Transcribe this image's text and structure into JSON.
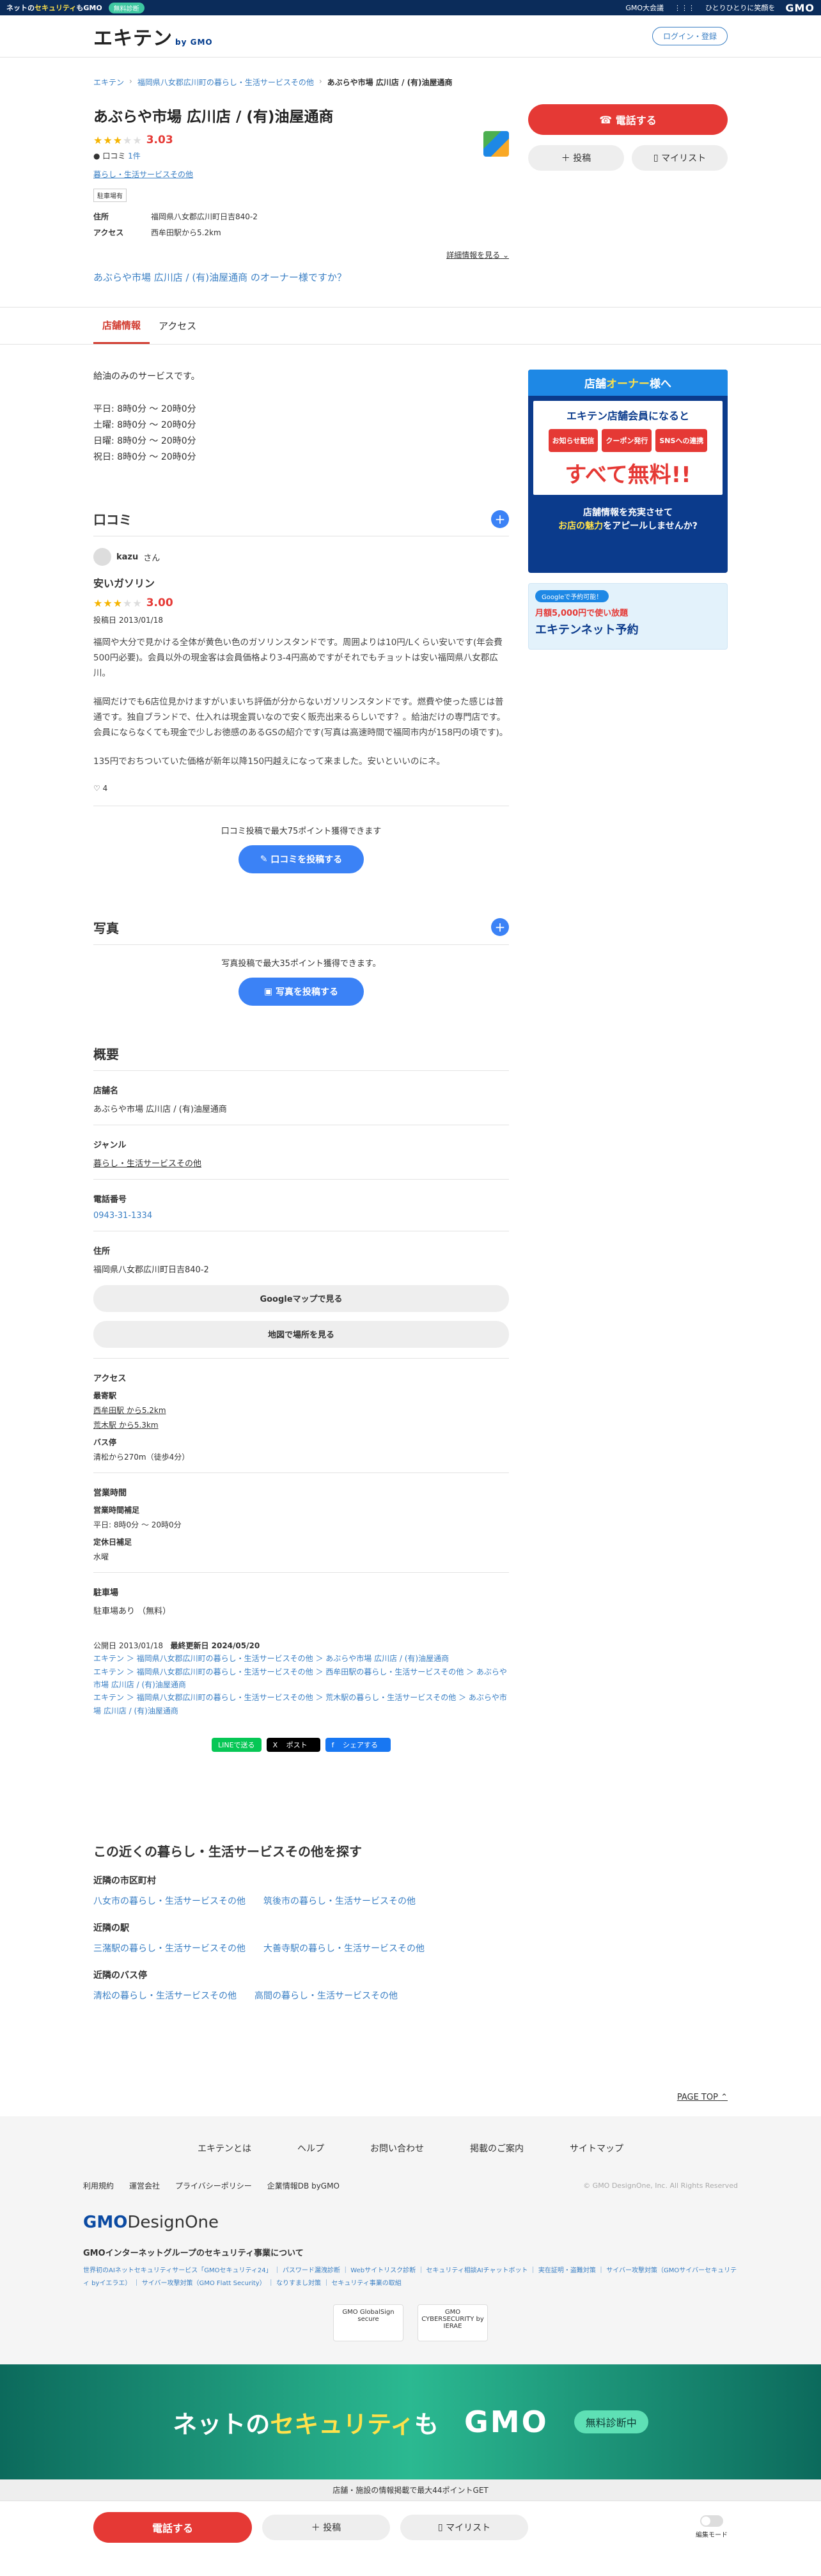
{
  "gmo_bar": {
    "left_text_1": "ネットの",
    "left_text_2": "セキュリティ",
    "left_text_3": "もGMO",
    "pill": "無料診断",
    "mid": "GMO大会議",
    "right_note": "ひとりひとりに笑顔を",
    "logo": "GMO"
  },
  "header": {
    "logo": "エキテン",
    "logo_sub": "by GMO",
    "login": "ログイン・登録"
  },
  "breadcrumb": [
    "エキテン",
    "福岡県八女郡広川町の暮らし・生活サービスその他",
    "あぶらや市場 広川店 / (有)油屋通商"
  ],
  "store": {
    "title": "あぶらや市場 広川店 / (有)油屋通商",
    "score": "3.03",
    "reviews_label": "口コミ",
    "reviews_count": "1件",
    "genre": "暮らし・生活サービスその他",
    "tag": "駐車場有",
    "address_label": "住所",
    "address": "福岡県八女郡広川町日吉840-2",
    "access_label": "アクセス",
    "access": "西牟田駅から5.2km",
    "more": "詳細情報を見る",
    "owner": "あぶらや市場 広川店 / (有)油屋通商 のオーナー様ですか？",
    "call": "電話する",
    "post": "＋ 投稿",
    "mylist": "マイリスト"
  },
  "tabs": [
    "店舗情報",
    "アクセス"
  ],
  "hours": {
    "service": "給油のみのサービスです。",
    "lines": [
      "平日: 8時0分 〜 20時0分",
      "土曜: 8時0分 〜 20時0分",
      "日曜: 8時0分 〜 20時0分",
      "祝日: 8時0分 〜 20時0分"
    ]
  },
  "reviews": {
    "heading": "口コミ",
    "user": "kazu",
    "user_suffix": "さん",
    "title": "安いガソリン",
    "score": "3.00",
    "date": "投稿日 2013/01/18",
    "body": [
      "福岡や大分で見かける全体が黄色い色のガソリンスタンドです。周囲よりは10円/Lくらい安いです(年会費500円必要)。会員以外の現金客は会員価格より3-4円高めですがそれでもチョットは安い福岡県八女郡広川。",
      "福岡だけでも6店位見かけますがいまいち評価が分からないガソリンスタンドです。燃費や使った感じは普通です。独自ブランドで、仕入れは現金買いなので安く販売出来るらしいです？。給油だけの専門店です。会員にならなくても現金で少しお徳感のあるGSの紹介です(写真は高速時間で福岡市内が158円の頃です)。",
      "135円でおちついていた価格が新年以降150円越えになって来ました。安いといいのにネ。"
    ],
    "likes": "4",
    "cta_text": "口コミ投稿で最大75ポイント獲得できます",
    "cta_btn": "口コミを投稿する"
  },
  "photos": {
    "heading": "写真",
    "cta_text": "写真投稿で最大35ポイント獲得できます。",
    "cta_btn": "写真を投稿する"
  },
  "overview": {
    "heading": "概要",
    "name_label": "店舗名",
    "name": "あぶらや市場 広川店 / (有)油屋通商",
    "genre_label": "ジャンル",
    "genre": "暮らし・生活サービスその他",
    "phone_label": "電話番号",
    "phone": "0943-31-1334",
    "address_label": "住所",
    "address": "福岡県八女郡広川町日吉840-2",
    "google_btn": "Googleマップで見る",
    "map_btn": "地図で場所を見る",
    "access_label": "アクセス",
    "station_label": "最寄駅",
    "station1": "西牟田駅 から5.2km",
    "station2": "荒木駅 から5.3km",
    "bus_label": "バス停",
    "bus": "清松から270m（徒歩4分）",
    "hours_label": "営業時間",
    "hours_sub": "営業時間補足",
    "hours_val": "平日: 8時0分 〜 20時0分",
    "holiday_sub": "定休日補足",
    "holiday_val": "水曜",
    "parking_label": "駐車場",
    "parking": "駐車場あり （無料）",
    "published": "公開日 2013/01/18",
    "updated": "最終更新日 2024/05/20",
    "bc1": "エキテン ＞ 福岡県八女郡広川町の暮らし・生活サービスその他 ＞ あぶらや市場 広川店 / (有)油屋通商",
    "bc2": "エキテン ＞ 福岡県八女郡広川町の暮らし・生活サービスその他 ＞ 西牟田駅の暮らし・生活サービスその他 ＞ あぶらや市場 広川店 / (有)油屋通商",
    "bc3": "エキテン ＞ 福岡県八女郡広川町の暮らし・生活サービスその他 ＞ 荒木駅の暮らし・生活サービスその他 ＞ あぶらや市場 広川店 / (有)油屋通商",
    "share_line": "LINEで送る",
    "share_x": "ポスト",
    "share_fb": "シェアする"
  },
  "nearby": {
    "heading": "この近くの暮らし・生活サービスその他を探す",
    "city_label": "近隣の市区町村",
    "city": [
      "八女市の暮らし・生活サービスその他",
      "筑後市の暮らし・生活サービスその他"
    ],
    "station_label": "近隣の駅",
    "station": [
      "三潴駅の暮らし・生活サービスその他",
      "大善寺駅の暮らし・生活サービスその他"
    ],
    "bus_label": "近隣のバス停",
    "bus": [
      "清松の暮らし・生活サービスその他",
      "高間の暮らし・生活サービスその他"
    ]
  },
  "page_top": "PAGE TOP",
  "footer": {
    "nav": [
      "エキテンとは",
      "ヘルプ",
      "お問い合わせ",
      "掲載のご案内",
      "サイトマップ"
    ],
    "links": [
      "利用規約",
      "運営会社",
      "プライバシーポリシー",
      "企業情報DB byGMO"
    ],
    "copyright": "© GMO DesignOne, Inc. All Rights Reserved",
    "logo_gmo": "GMO",
    "logo_rest": "DesignOne",
    "sec_title": "GMOインターネットグループのセキュリティ事業について",
    "sec_links": "世界初のAIネットセキュリティサービス「GMOセキュリティ24」 ｜ パスワード漏洩診断 ｜ Webサイトリスク診断 ｜ セキュリティ相談AIチャットボット ｜ 実在証明・盗難対策 ｜ サイバー攻撃対策（GMOサイバーセキュリティ byイエラエ） ｜ サイバー攻撃対策（GMO Flatt Security） ｜ なりすまし対策 ｜ セキュリティ事業の取組",
    "badge1": "GMO GlobalSign secure",
    "badge2": "GMO CYBERSECURITY by IERAE"
  },
  "big_banner": {
    "t1": "ネットの",
    "t2": "セキュリティ",
    "t3": "も",
    "g": "GMO",
    "pill": "無料診断中"
  },
  "point_bar": "店舗・施設の情報掲載で最大44ポイントGET",
  "bottom_bar": {
    "call": "電話する",
    "post": "＋ 投稿",
    "mylist": "マイリスト",
    "toggle": "編集モード"
  },
  "side": {
    "ad1_head_1": "店舗",
    "ad1_head_2": "オーナー",
    "ad1_head_3": "様へ",
    "ad1_l1": "エキテン店舗会員になると",
    "ad1_chips": [
      "お知らせ配信",
      "クーポン発行",
      "SNSへの連携"
    ],
    "ad1_free": "すべて無料!!",
    "ad1_f1": "店舗情報を充実させて",
    "ad1_f2": "お店の魅力",
    "ad1_f3": "をアピールしませんか?",
    "ad2_badge": "Googleで予約可能！",
    "ad2_l": "月額5,000円で使い放題",
    "ad2_n": "エキテンネット予約"
  }
}
